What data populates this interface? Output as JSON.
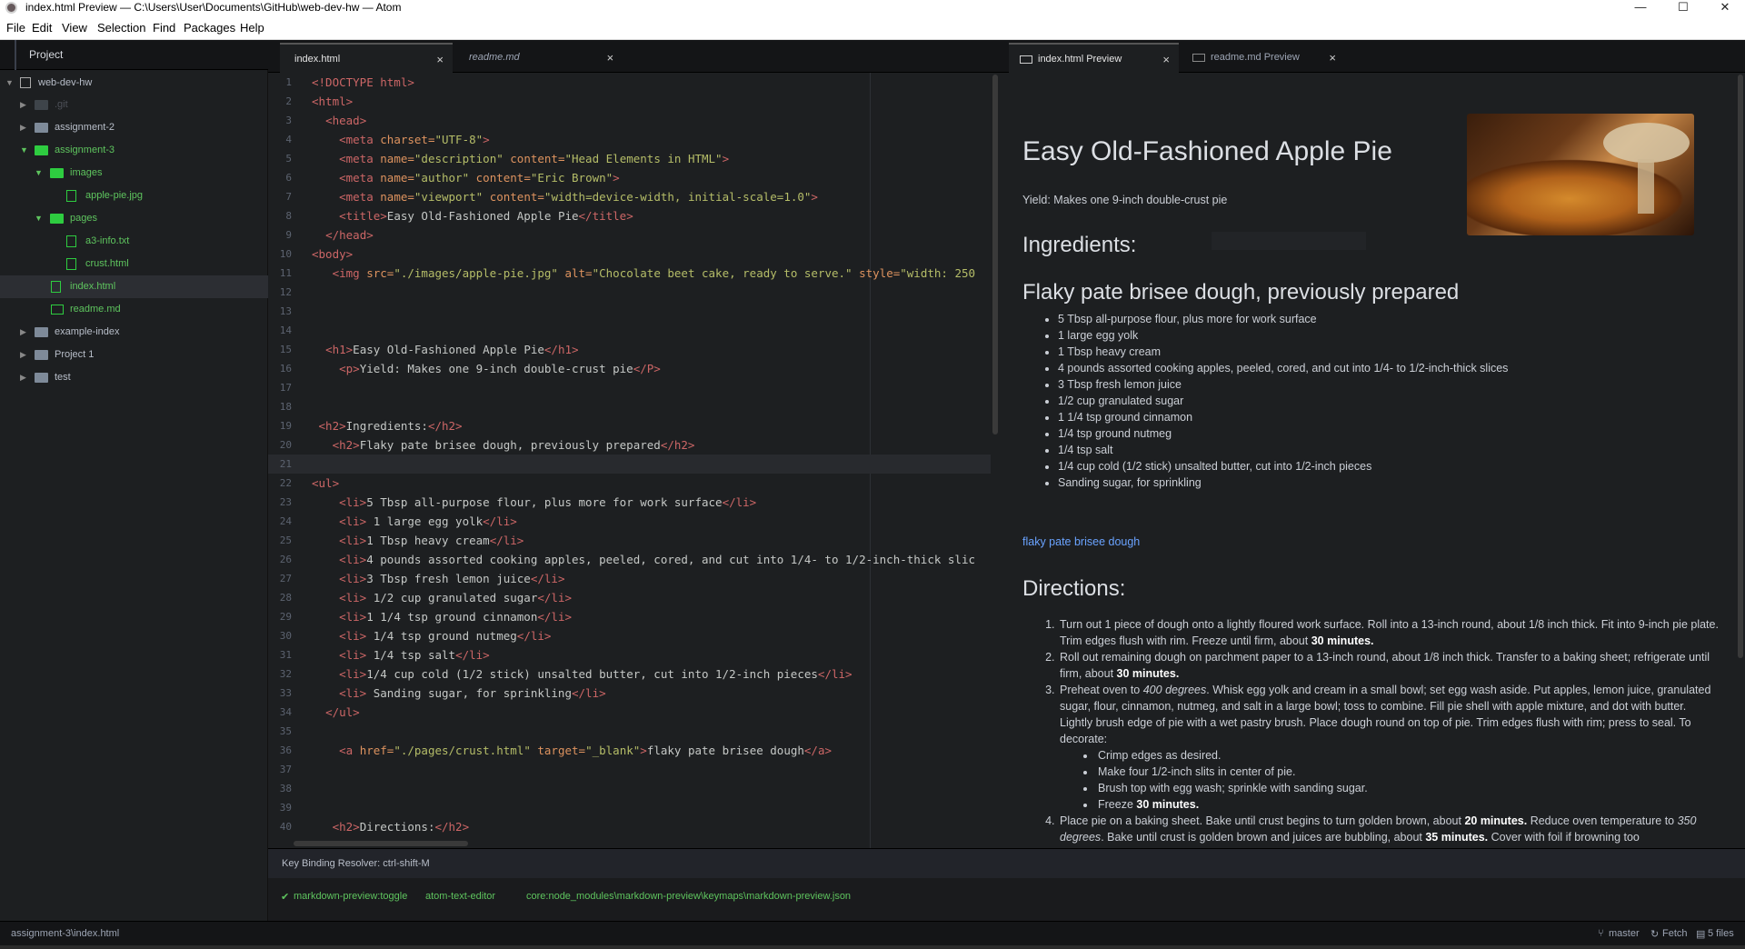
{
  "window": {
    "title": "index.html Preview — C:\\Users\\User\\Documents\\GitHub\\web-dev-hw — Atom",
    "minimize": "—",
    "maximize": "☐",
    "close": "✕"
  },
  "menu": [
    "File",
    "Edit",
    "View",
    "Selection",
    "Find",
    "Packages",
    "Help"
  ],
  "tree": {
    "tab": "Project",
    "items": [
      {
        "label": "web-dev-hw",
        "type": "repo"
      },
      {
        "label": ".git",
        "type": "folder-muted"
      },
      {
        "label": "assignment-2",
        "type": "folder"
      },
      {
        "label": "assignment-3",
        "type": "folder-green"
      },
      {
        "label": "images",
        "type": "folder-green"
      },
      {
        "label": "apple-pie.jpg",
        "type": "file"
      },
      {
        "label": "pages",
        "type": "folder-green"
      },
      {
        "label": "a3-info.txt",
        "type": "file"
      },
      {
        "label": "crust.html",
        "type": "file"
      },
      {
        "label": "index.html",
        "type": "file"
      },
      {
        "label": "readme.md",
        "type": "file"
      },
      {
        "label": "example-index",
        "type": "folder"
      },
      {
        "label": "Project 1",
        "type": "folder"
      },
      {
        "label": "test",
        "type": "folder"
      }
    ]
  },
  "tabs": {
    "left": [
      {
        "label": "index.html"
      },
      {
        "label": "readme.md"
      }
    ],
    "right": [
      {
        "label": "index.html Preview"
      },
      {
        "label": "readme.md Preview"
      }
    ],
    "close": "×"
  },
  "editor": {
    "line_numbers": [
      "1",
      "2",
      "3",
      "4",
      "5",
      "6",
      "7",
      "8",
      "9",
      "10",
      "11",
      "12",
      "13",
      "14",
      "15",
      "16",
      "17",
      "18",
      "19",
      "20",
      "21",
      "22",
      "23",
      "24",
      "25",
      "26",
      "27",
      "28",
      "29",
      "30",
      "31",
      "32",
      "33",
      "34",
      "35",
      "36",
      "37",
      "38",
      "39",
      "40"
    ],
    "lines": [
      [
        [
          "t",
          "<!DOCTYPE html>"
        ]
      ],
      [
        [
          "t",
          "<html>"
        ]
      ],
      [
        [
          "tx",
          "  "
        ],
        [
          "t",
          "<head>"
        ]
      ],
      [
        [
          "tx",
          "    "
        ],
        [
          "t",
          "<meta "
        ],
        [
          "a",
          "charset="
        ],
        [
          "s",
          "\"UTF-8\""
        ],
        [
          "t",
          ">"
        ]
      ],
      [
        [
          "tx",
          "    "
        ],
        [
          "t",
          "<meta "
        ],
        [
          "a",
          "name="
        ],
        [
          "s",
          "\"description\" "
        ],
        [
          "a",
          "content="
        ],
        [
          "s",
          "\"Head Elements in HTML\""
        ],
        [
          "t",
          ">"
        ]
      ],
      [
        [
          "tx",
          "    "
        ],
        [
          "t",
          "<meta "
        ],
        [
          "a",
          "name="
        ],
        [
          "s",
          "\"author\" "
        ],
        [
          "a",
          "content="
        ],
        [
          "s",
          "\"Eric Brown\""
        ],
        [
          "t",
          ">"
        ]
      ],
      [
        [
          "tx",
          "    "
        ],
        [
          "t",
          "<meta "
        ],
        [
          "a",
          "name="
        ],
        [
          "s",
          "\"viewport\" "
        ],
        [
          "a",
          "content="
        ],
        [
          "s",
          "\"width=device-width, initial-scale=1.0\""
        ],
        [
          "t",
          ">"
        ]
      ],
      [
        [
          "tx",
          "    "
        ],
        [
          "t",
          "<title>"
        ],
        [
          "tx",
          "Easy Old-Fashioned Apple Pie"
        ],
        [
          "t",
          "</title>"
        ]
      ],
      [
        [
          "tx",
          "  "
        ],
        [
          "t",
          "</head>"
        ]
      ],
      [
        [
          "t",
          "<body>"
        ]
      ],
      [
        [
          "tx",
          "   "
        ],
        [
          "t",
          "<img "
        ],
        [
          "a",
          "src="
        ],
        [
          "s",
          "\"./images/apple-pie.jpg\" "
        ],
        [
          "a",
          "alt="
        ],
        [
          "s",
          "\"Chocolate beet cake, ready to serve.\" "
        ],
        [
          "a",
          "style="
        ],
        [
          "s",
          "\"width: 250"
        ]
      ],
      [],
      [],
      [],
      [
        [
          "tx",
          "  "
        ],
        [
          "t",
          "<h1>"
        ],
        [
          "tx",
          "Easy Old-Fashioned Apple Pie"
        ],
        [
          "t",
          "</h1>"
        ]
      ],
      [
        [
          "tx",
          "    "
        ],
        [
          "t",
          "<p>"
        ],
        [
          "tx",
          "Yield: Makes one 9-inch double-crust pie"
        ],
        [
          "t",
          "</P>"
        ]
      ],
      [],
      [],
      [
        [
          "tx",
          " "
        ],
        [
          "t",
          "<h2>"
        ],
        [
          "tx",
          "Ingredients:"
        ],
        [
          "t",
          "</h2>"
        ]
      ],
      [
        [
          "tx",
          "   "
        ],
        [
          "t",
          "<h2>"
        ],
        [
          "tx",
          "Flaky pate brisee dough, previously prepared"
        ],
        [
          "t",
          "</h2>"
        ]
      ],
      [],
      [
        [
          "t",
          "<ul>"
        ]
      ],
      [
        [
          "tx",
          "    "
        ],
        [
          "t",
          "<li>"
        ],
        [
          "tx",
          "5 Tbsp all-purpose flour, plus more for work surface"
        ],
        [
          "t",
          "</li>"
        ]
      ],
      [
        [
          "tx",
          "    "
        ],
        [
          "t",
          "<li>"
        ],
        [
          "tx",
          " 1 large egg yolk"
        ],
        [
          "t",
          "</li>"
        ]
      ],
      [
        [
          "tx",
          "    "
        ],
        [
          "t",
          "<li>"
        ],
        [
          "tx",
          "1 Tbsp heavy cream"
        ],
        [
          "t",
          "</li>"
        ]
      ],
      [
        [
          "tx",
          "    "
        ],
        [
          "t",
          "<li>"
        ],
        [
          "tx",
          "4 pounds assorted cooking apples, peeled, cored, and cut into 1/4- to 1/2-inch-thick slic"
        ]
      ],
      [
        [
          "tx",
          "    "
        ],
        [
          "t",
          "<li>"
        ],
        [
          "tx",
          "3 Tbsp fresh lemon juice"
        ],
        [
          "t",
          "</li>"
        ]
      ],
      [
        [
          "tx",
          "    "
        ],
        [
          "t",
          "<li>"
        ],
        [
          "tx",
          " 1/2 cup granulated sugar"
        ],
        [
          "t",
          "</li>"
        ]
      ],
      [
        [
          "tx",
          "    "
        ],
        [
          "t",
          "<li>"
        ],
        [
          "tx",
          "1 1/4 tsp ground cinnamon"
        ],
        [
          "t",
          "</li>"
        ]
      ],
      [
        [
          "tx",
          "    "
        ],
        [
          "t",
          "<li>"
        ],
        [
          "tx",
          " 1/4 tsp ground nutmeg"
        ],
        [
          "t",
          "</li>"
        ]
      ],
      [
        [
          "tx",
          "    "
        ],
        [
          "t",
          "<li>"
        ],
        [
          "tx",
          " 1/4 tsp salt"
        ],
        [
          "t",
          "</li>"
        ]
      ],
      [
        [
          "tx",
          "    "
        ],
        [
          "t",
          "<li>"
        ],
        [
          "tx",
          "1/4 cup cold (1/2 stick) unsalted butter, cut into 1/2-inch pieces"
        ],
        [
          "t",
          "</li>"
        ]
      ],
      [
        [
          "tx",
          "    "
        ],
        [
          "t",
          "<li>"
        ],
        [
          "tx",
          " Sanding sugar, for sprinkling"
        ],
        [
          "t",
          "</li>"
        ]
      ],
      [
        [
          "tx",
          "  "
        ],
        [
          "t",
          "</ul>"
        ]
      ],
      [],
      [
        [
          "tx",
          "    "
        ],
        [
          "t",
          "<a "
        ],
        [
          "a",
          "href="
        ],
        [
          "s",
          "\"./pages/crust.html\" "
        ],
        [
          "a",
          "target="
        ],
        [
          "s",
          "\"_blank\""
        ],
        [
          "t",
          ">"
        ],
        [
          "tx",
          "flaky pate brisee dough"
        ],
        [
          "t",
          "</a>"
        ]
      ],
      [],
      [],
      [],
      [
        [
          "tx",
          "   "
        ],
        [
          "t",
          "<h2>"
        ],
        [
          "tx",
          "Directions:"
        ],
        [
          "t",
          "</h2>"
        ]
      ]
    ]
  },
  "preview": {
    "h1": "Easy Old-Fashioned Apple Pie",
    "yield": "Yield: Makes one 9-inch double-crust pie",
    "img_alt": "Chocolate beet cake, ready to serve.",
    "ingredients": "Ingredients:",
    "dough": "Flaky pate brisee dough, previously prepared",
    "list": [
      "5 Tbsp all-purpose flour, plus more for work surface",
      "1 large egg yolk",
      "1 Tbsp heavy cream",
      "4 pounds assorted cooking apples, peeled, cored, and cut into 1/4- to 1/2-inch-thick slices",
      "3 Tbsp fresh lemon juice",
      "1/2 cup granulated sugar",
      "1 1/4 tsp ground cinnamon",
      "1/4 tsp ground nutmeg",
      "1/4 tsp salt",
      "1/4 cup cold (1/2 stick) unsalted butter, cut into 1/2-inch pieces",
      "Sanding sugar, for sprinkling"
    ],
    "link": "flaky pate brisee dough",
    "directions": "Directions:",
    "steps": {
      "s1a": "Turn out 1 piece of dough onto a lightly floured work surface. Roll into a 13-inch round, about 1/8 inch thick. Fit into 9-inch pie plate. Trim edges flush with rim. Freeze until firm, about ",
      "s1b": "30 minutes.",
      "s2a": "Roll out remaining dough on parchment paper to a 13-inch round, about 1/8 inch thick. Transfer to a baking sheet; refrigerate until firm, about ",
      "s2b": "30 minutes.",
      "s3a": "Preheat oven to ",
      "s3b": "400 degrees",
      "s3c": ". Whisk egg yolk and cream in a small bowl; set egg wash aside. Put apples, lemon juice, granulated sugar, flour, cinnamon, nutmeg, and salt in a large bowl; toss to combine. Fill pie shell with apple mixture, and dot with butter. Lightly brush edge of pie with a wet pastry brush. Place dough round on top of pie. Trim edges flush with rim; press to seal. To decorate:",
      "sub1": "Crimp edges as desired.",
      "sub2": "Make four 1/2-inch slits in center of pie.",
      "sub3": "Brush top with egg wash; sprinkle with sanding sugar.",
      "sub4a": "Freeze ",
      "sub4b": "30 minutes.",
      "s4a": "Place pie on a baking sheet. Bake until crust begins to turn golden brown, about ",
      "s4b": "20 minutes.",
      "s4c": " Reduce oven temperature to ",
      "s4d": "350 degrees",
      "s4e": ". Bake until crust is golden brown and juices are bubbling, about ",
      "s4f": "35 minutes.",
      "s4g": " Cover with foil if browning too"
    }
  },
  "resolver": {
    "title": "Key Binding Resolver: ctrl-shift-M",
    "command": "markdown-preview:toggle",
    "selector": "atom-text-editor",
    "source": "core:node_modules\\markdown-preview\\keymaps\\markdown-preview.json"
  },
  "status": {
    "path": "assignment-3\\index.html",
    "branch": "master",
    "fetch": "Fetch",
    "files": "5 files"
  },
  "colors": {
    "accent_green": "#5ec45e",
    "tag": "#cc6666",
    "attr": "#de935f",
    "string": "#b5bd68",
    "link": "#6aa3ff"
  }
}
